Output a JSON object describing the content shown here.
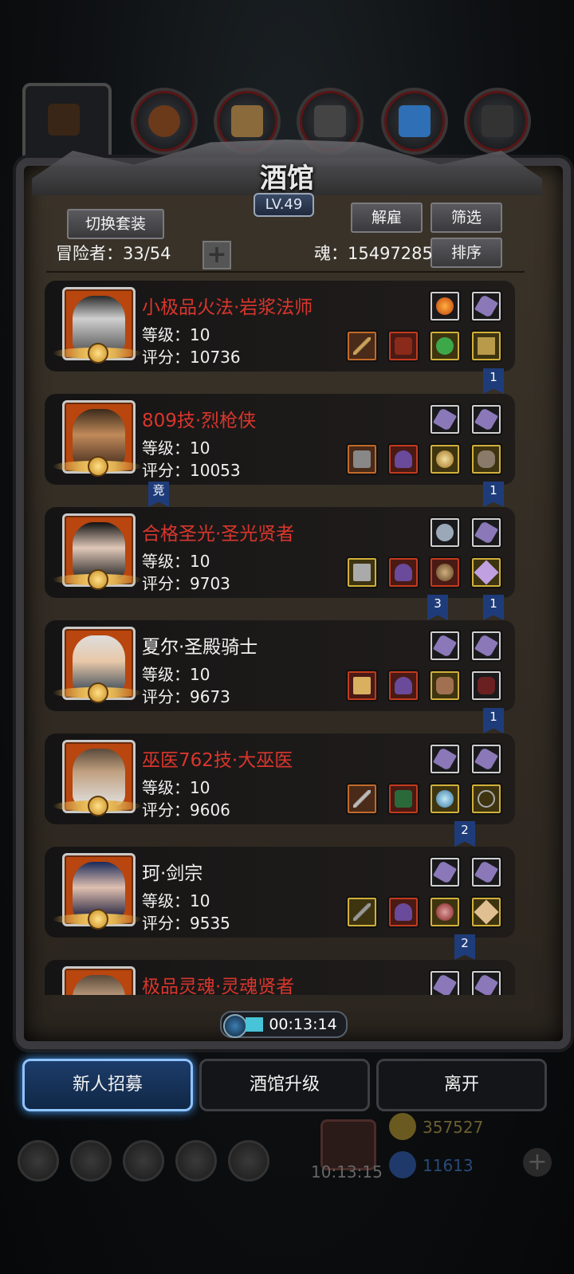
{
  "header": {
    "title": "酒馆",
    "level": "LV.49",
    "switch_set_label": "切换套装",
    "dismiss_label": "解雇",
    "filter_label": "筛选",
    "sort_label": "排序",
    "adventurers_text": "冒险者：33/54",
    "soul_text": "魂：15497285",
    "top_soul_partial": "15?????5"
  },
  "heroes": [
    {
      "name": "小极品火法·岩浆法师",
      "name_color": "red",
      "level": "等级：10",
      "score": "评分：10736",
      "flag_right": "1"
    },
    {
      "name": "809技·烈枪侠",
      "name_color": "red",
      "level": "等级：10",
      "score": "评分：10053",
      "flag_right": "1",
      "flag_left": "竞"
    },
    {
      "name": "合格圣光·圣光贤者",
      "name_color": "red",
      "level": "等级：10",
      "score": "评分：9703",
      "flag_right": "1",
      "flag_mid": "3"
    },
    {
      "name": "夏尔·圣殿骑士",
      "name_color": "white",
      "level": "等级：10",
      "score": "评分：9673",
      "flag_right": "1"
    },
    {
      "name": "巫医762技·大巫医",
      "name_color": "red",
      "level": "等级：10",
      "score": "评分：9606",
      "flag_right": "2"
    },
    {
      "name": "珂·剑宗",
      "name_color": "white",
      "level": "等级：10",
      "score": "评分：9535",
      "flag_right": "2"
    },
    {
      "name": "极品灵魂·灵魂贤者",
      "name_color": "red",
      "level": "",
      "score": ""
    }
  ],
  "timer": "00:13:14",
  "actions": {
    "recruit": "新人招募",
    "upgrade": "酒馆升级",
    "leave": "离开"
  },
  "footer": {
    "gift_timer": "10:13:15",
    "gold": "357527",
    "gems": "11613"
  },
  "colors": {
    "name_red": "#d9362d",
    "accent_blue": "#8fc3ff",
    "panel_bg": "#2b251f"
  }
}
